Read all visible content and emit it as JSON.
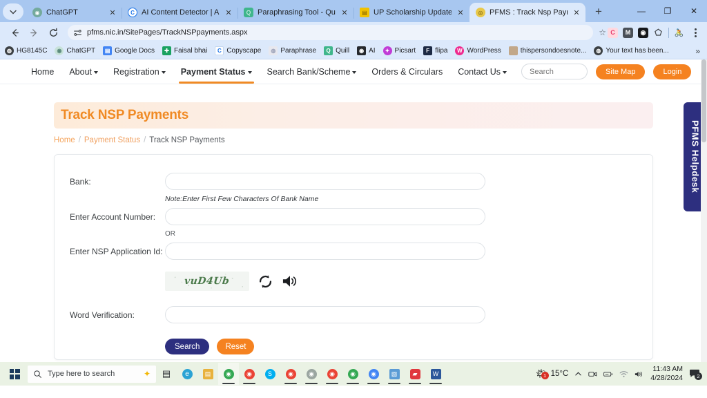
{
  "browser": {
    "tabs": [
      {
        "title": "ChatGPT",
        "favicon": "chatgpt-icon",
        "color": "#74aa9c",
        "glyph": "◉",
        "active": false
      },
      {
        "title": "AI Content Detector | AI Det",
        "favicon": "copyleaks-icon",
        "color": "#ffffff",
        "glyph": "C",
        "active": false
      },
      {
        "title": "Paraphrasing Tool - QuillBot",
        "favicon": "quillbot-icon",
        "color": "#3fb68b",
        "glyph": "Q",
        "active": false
      },
      {
        "title": "UP Scholarship Updates - UP",
        "favicon": "news-icon",
        "color": "#f2c200",
        "glyph": "▤",
        "active": false
      },
      {
        "title": "PFMS : Track Nsp Payments",
        "favicon": "pfms-icon",
        "color": "#d4a017",
        "glyph": "◎",
        "active": true
      }
    ],
    "new_tab_label": "+",
    "close_label": "✕",
    "window_controls": {
      "minimize": "—",
      "maximize": "❐",
      "close": "✕"
    },
    "omnibox": {
      "url": "pfms.nic.in/SitePages/TrackNSPpayments.aspx",
      "site_info_icon": "site-settings-icon",
      "star_icon": "bookmark-star-icon",
      "back_icon": "back-arrow-icon",
      "forward_icon": "forward-arrow-icon",
      "reload_icon": "reload-icon"
    },
    "extensions": [
      {
        "name": "copyleaks-extension-icon",
        "glyph": "C",
        "bg": "#ffd9e0",
        "fg": "#e8396a"
      },
      {
        "name": "grammarly-extension-icon",
        "glyph": "M",
        "bg": "#4a5058",
        "fg": "#ffffff"
      },
      {
        "name": "dark-reader-extension-icon",
        "glyph": "◉",
        "bg": "#16181b",
        "fg": "#ffffff"
      },
      {
        "name": "extensions-puzzle-icon",
        "glyph": "⬡",
        "bg": "transparent",
        "fg": "#3c4043"
      },
      {
        "name": "profile-avatar-icon",
        "glyph": "🚴",
        "bg": "transparent",
        "fg": "#3c4043"
      }
    ],
    "menu_icon": "chrome-menu-kebab-icon",
    "bookmarks": [
      {
        "label": "HG8145C",
        "icon": "globe-icon",
        "glyph": "🌐",
        "bg": "#3c4043"
      },
      {
        "label": "ChatGPT",
        "icon": "chatgpt-icon",
        "glyph": "◉",
        "bg": "#c7e2d9"
      },
      {
        "label": "Google Docs",
        "icon": "google-docs-icon",
        "glyph": "▤",
        "bg": "#4285f4"
      },
      {
        "label": "Faisal bhai",
        "icon": "sheets-icon",
        "glyph": "✚",
        "bg": "#1aa260"
      },
      {
        "label": "Copyscape",
        "icon": "copyscape-icon",
        "glyph": "C",
        "bg": "#ffffff"
      },
      {
        "label": "Paraphrase",
        "icon": "paraphrase-icon",
        "glyph": "◍",
        "bg": "#e8e8ee"
      },
      {
        "label": "Quill",
        "icon": "quillbot-icon",
        "glyph": "Q",
        "bg": "#3fb68b"
      },
      {
        "label": "AI",
        "icon": "ai-detector-icon",
        "glyph": "◉",
        "bg": "#26292e"
      },
      {
        "label": "Picsart",
        "icon": "picsart-icon",
        "glyph": "✦",
        "bg": "#c13cd6"
      },
      {
        "label": "flipa",
        "icon": "flipa-icon",
        "glyph": "F",
        "bg": "#1d2a44"
      },
      {
        "label": "WordPress",
        "icon": "wordpress-icon",
        "glyph": "W",
        "bg": "#ef2a8e"
      },
      {
        "label": "thispersondoesnote...",
        "icon": "face-thumbnail-icon",
        "glyph": "🙂",
        "bg": "#c2a88a"
      },
      {
        "label": "Your text has been...",
        "icon": "globe-icon",
        "glyph": "🌐",
        "bg": "#3c4043"
      }
    ],
    "bookmarks_overflow_label": "»"
  },
  "site": {
    "nav": [
      {
        "label": "Home",
        "has_caret": false,
        "active": false
      },
      {
        "label": "About",
        "has_caret": true,
        "active": false
      },
      {
        "label": "Registration",
        "has_caret": true,
        "active": false
      },
      {
        "label": "Payment Status",
        "has_caret": true,
        "active": true
      },
      {
        "label": "Search Bank/Scheme",
        "has_caret": true,
        "active": false
      },
      {
        "label": "Orders & Circulars",
        "has_caret": false,
        "active": false
      },
      {
        "label": "Contact Us",
        "has_caret": true,
        "active": false
      }
    ],
    "search_placeholder": "Search",
    "sitemap_label": "Site Map",
    "login_label": "Login",
    "accent_orange": "#f58220",
    "accent_navy": "#2d2f7f"
  },
  "main": {
    "page_title": "Track NSP Payments",
    "breadcrumb": {
      "home": "Home",
      "sep1": "/",
      "parent": "Payment Status",
      "sep2": "/",
      "current": "Track NSP Payments"
    },
    "form": {
      "bank_label": "Bank:",
      "bank_value": "",
      "bank_note": "Note:Enter First Few Characters Of Bank Name",
      "account_label": "Enter Account Number:",
      "account_value": "",
      "or_text": "OR",
      "nsp_id_label": "Enter NSP Application Id:",
      "nsp_id_value": "",
      "captcha_text": "vuD4Ub",
      "refresh_icon": "refresh-captcha-icon",
      "audio_icon": "audio-captcha-icon",
      "word_verification_label": "Word Verification:",
      "word_verification_value": "",
      "search_button": "Search",
      "reset_button": "Reset"
    }
  },
  "helpdesk": {
    "label": "PFMS Helpdesk"
  },
  "taskbar": {
    "start_icon": "windows-start-icon",
    "search_placeholder": "Type here to search",
    "search_icon": "magnifier-icon",
    "sparkle_icon": "copilot-sparkle-icon",
    "items": [
      {
        "name": "task-view-icon",
        "glyph": "▤",
        "bg": "transparent",
        "fg": "#2c2f33",
        "running": false,
        "active": false
      },
      {
        "name": "microsoft-edge-icon",
        "glyph": "e",
        "bg": "#2ba3d4",
        "fg": "#ffffff",
        "running": false,
        "active": false
      },
      {
        "name": "file-explorer-icon",
        "glyph": "▤",
        "bg": "#e8b23c",
        "fg": "#ffffff",
        "running": false,
        "active": false
      },
      {
        "name": "chrome-icon",
        "glyph": "◉",
        "bg": "#34a853",
        "fg": "#ffffff",
        "running": true,
        "active": true
      },
      {
        "name": "chrome-icon",
        "glyph": "◉",
        "bg": "#ea4335",
        "fg": "#ffffff",
        "running": true,
        "active": false
      },
      {
        "name": "skype-icon",
        "glyph": "S",
        "bg": "#00aff0",
        "fg": "#ffffff",
        "running": false,
        "active": false
      },
      {
        "name": "chrome-icon",
        "glyph": "◉",
        "bg": "#ea4335",
        "fg": "#ffffff",
        "running": true,
        "active": false
      },
      {
        "name": "chrome-icon",
        "glyph": "◉",
        "bg": "#9aa5a0",
        "fg": "#ffffff",
        "running": true,
        "active": false
      },
      {
        "name": "chrome-icon",
        "glyph": "◉",
        "bg": "#34a853",
        "fg": "#ffffff",
        "running": true,
        "active": false
      },
      {
        "name": "chrome-icon",
        "glyph": "◉",
        "bg": "#4285f4",
        "fg": "#ffffff",
        "running": true,
        "active": false
      },
      {
        "name": "chrome-icon",
        "glyph": "◉",
        "bg": "#34a853",
        "fg": "#ffffff",
        "running": true,
        "active": false
      },
      {
        "name": "notepad-icon",
        "glyph": "▦",
        "bg": "#5b9bd5",
        "fg": "#ffffff",
        "running": true,
        "active": false
      },
      {
        "name": "adobe-reader-icon",
        "glyph": "▰",
        "bg": "#e0383e",
        "fg": "#ffffff",
        "running": true,
        "active": false
      },
      {
        "name": "word-icon",
        "glyph": "W",
        "bg": "#2b579a",
        "fg": "#ffffff",
        "running": true,
        "active": false
      }
    ],
    "weather": {
      "icon": "partly-sunny-icon",
      "temp": "15°C",
      "badge": "1"
    },
    "tray": [
      {
        "name": "show-hidden-icons-chevron",
        "glyph": "^"
      },
      {
        "name": "camera-privacy-icon",
        "glyph": "▣"
      },
      {
        "name": "battery-icon",
        "glyph": "▭"
      },
      {
        "name": "wifi-icon",
        "glyph": "◗"
      },
      {
        "name": "volume-icon",
        "glyph": "🔊"
      }
    ],
    "clock": {
      "time": "11:43 AM",
      "date": "4/28/2024"
    },
    "notifications": {
      "icon": "notification-icon",
      "count": "2"
    }
  }
}
